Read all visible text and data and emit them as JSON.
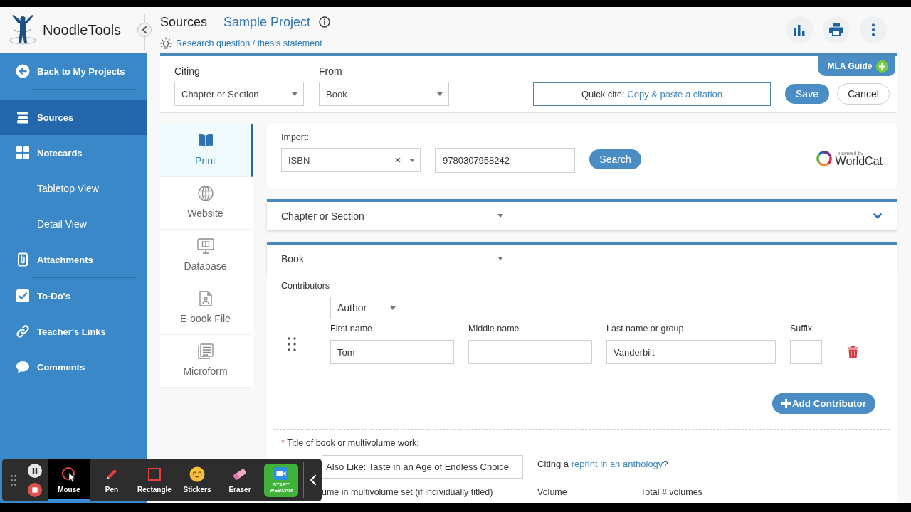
{
  "brand": {
    "name": "NoodleTools"
  },
  "sidebar": {
    "groups": [
      {
        "items": [
          {
            "label": "Back to My Projects",
            "selected": false
          }
        ]
      },
      {
        "items": [
          {
            "label": "Sources",
            "selected": true
          },
          {
            "label": "Notecards",
            "selected": false,
            "children": [
              {
                "label": "Tabletop View",
                "selected": false
              },
              {
                "label": "Detail View",
                "selected": false
              }
            ]
          },
          {
            "label": "Attachments",
            "selected": false
          }
        ]
      },
      {
        "items": [
          {
            "label": "To-Do's",
            "selected": false
          },
          {
            "label": "Teacher's Links",
            "selected": false
          },
          {
            "label": "Comments",
            "selected": false
          }
        ]
      }
    ]
  },
  "header": {
    "section": "Sources",
    "project": "Sample Project",
    "research_link": "Research question / thesis statement"
  },
  "citation_bar": {
    "citing": {
      "label": "Citing",
      "value": "Chapter or Section"
    },
    "from": {
      "label": "From",
      "value": "Book"
    },
    "guide_tab": "MLA Guide",
    "quick_cite": {
      "label": "Quick cite:",
      "link": "Copy & paste a citation"
    },
    "buttons": [
      {
        "label": "Save",
        "kind": "primary"
      },
      {
        "label": "Cancel",
        "kind": "secondary"
      }
    ]
  },
  "source_types": [
    {
      "label": "Print",
      "selected": true
    },
    {
      "label": "Website",
      "selected": false
    },
    {
      "label": "Database",
      "selected": false
    },
    {
      "label": "E-book File",
      "selected": false
    },
    {
      "label": "Microform",
      "selected": false
    }
  ],
  "import": {
    "label": "Import:",
    "type": "ISBN",
    "value": "9780307958242",
    "button": "Search",
    "provider_note": "powered by",
    "provider": "WorldCat"
  },
  "sections": [
    {
      "title": "Chapter or Section",
      "collapsed": true
    },
    {
      "title": "Book",
      "collapsed": false
    }
  ],
  "contributors": {
    "label": "Contributors",
    "rows": [
      {
        "role": "Author",
        "fields": [
          {
            "label": "First name",
            "value": "Tom"
          },
          {
            "label": "Middle name"
          },
          {
            "label": "Last name or group",
            "value": "Vanderbilt"
          },
          {
            "label": "Suffix"
          }
        ]
      }
    ],
    "add_button": "Add Contributor"
  },
  "title_field": {
    "required_mark": "*",
    "label": "Title of book or multivolume work:",
    "value": "Also Like: Taste in an Age of Endless Choice"
  },
  "reprint_note": {
    "before": "Citing a",
    "link": "reprint in an anthology",
    "after": "?"
  },
  "next_fields": [
    {
      "label": "ume in multivolume set (if individually titled)"
    },
    {
      "label": "Volume"
    },
    {
      "label": "Total # volumes"
    }
  ],
  "recorder": {
    "tools": [
      {
        "label": "Mouse",
        "selected": true
      },
      {
        "label": "Pen",
        "selected": false
      },
      {
        "label": "Rectangle",
        "selected": false
      },
      {
        "label": "Stickers",
        "selected": false
      },
      {
        "label": "Eraser",
        "selected": false
      }
    ],
    "webcam_button": "START WEBCAM"
  }
}
